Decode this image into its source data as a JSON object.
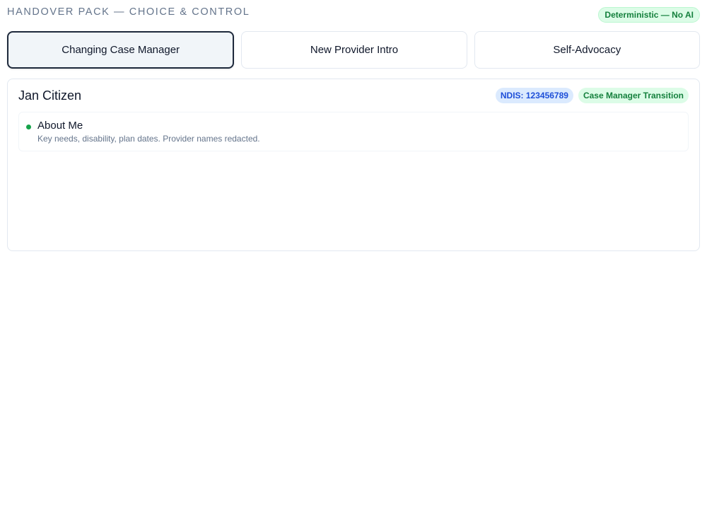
{
  "header": {
    "title": "HANDOVER PACK — CHOICE & CONTROL",
    "mode_badge": "Deterministic — No AI"
  },
  "tabs": [
    {
      "label": "Changing Case Manager",
      "active": true
    },
    {
      "label": "New Provider Intro",
      "active": false
    },
    {
      "label": "Self-Advocacy",
      "active": false
    }
  ],
  "card": {
    "name": "Jan Citizen",
    "ndis_badge": "NDIS: 123456789",
    "status_badge": "Case Manager Transition",
    "sections": [
      {
        "title": "About Me",
        "description": "Key needs, disability, plan dates. Provider names redacted."
      }
    ]
  },
  "colors": {
    "accent_dark": "#1e293b",
    "success": "#16a34a",
    "info": "#1d4ed8"
  }
}
